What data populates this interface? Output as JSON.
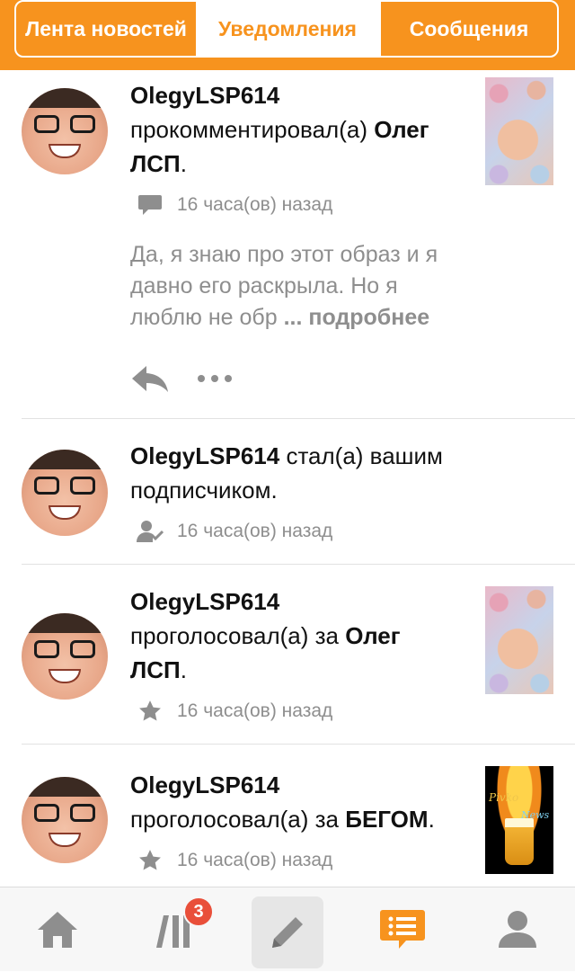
{
  "tabs": [
    {
      "label": "Лента новостей"
    },
    {
      "label": "Уведомления"
    },
    {
      "label": "Сообщения"
    }
  ],
  "notifications": [
    {
      "user": "OlegyLSP614",
      "action": "прокомментировал(а)",
      "object": "Олег ЛСП",
      "object_suffix": ".",
      "time": "16 часа(ов) назад",
      "type_icon": "comment-icon",
      "comment": "Да, я знаю про этот образ и я давно его раскрыла. Но я люблю не обр",
      "ellipsis": "...",
      "more_label": "подробнее"
    },
    {
      "user": "OlegyLSP614",
      "action": "стал(а) вашим подписчиком.",
      "time": "16 часа(ов) назад",
      "type_icon": "user-check-icon"
    },
    {
      "user": "OlegyLSP614",
      "action": "проголосовал(а) за",
      "object": "Олег ЛСП",
      "object_suffix": ".",
      "time": "16 часа(ов) назад",
      "type_icon": "star-icon"
    },
    {
      "user": "OlegyLSP614",
      "action": "проголосовал(а) за",
      "object": "БЕГОМ",
      "object_suffix": ".",
      "time": "16 часа(ов) назад",
      "type_icon": "star-icon",
      "thumb_text": [
        "Pivko",
        "News"
      ]
    }
  ],
  "bottom_nav": {
    "items": [
      "home-icon",
      "feed-icon",
      "edit-icon",
      "chat-icon",
      "profile-icon"
    ],
    "badge_count": "3"
  },
  "colors": {
    "accent": "#f7931e",
    "text_gray": "#8e8e8e",
    "badge_red": "#e94f3a"
  }
}
